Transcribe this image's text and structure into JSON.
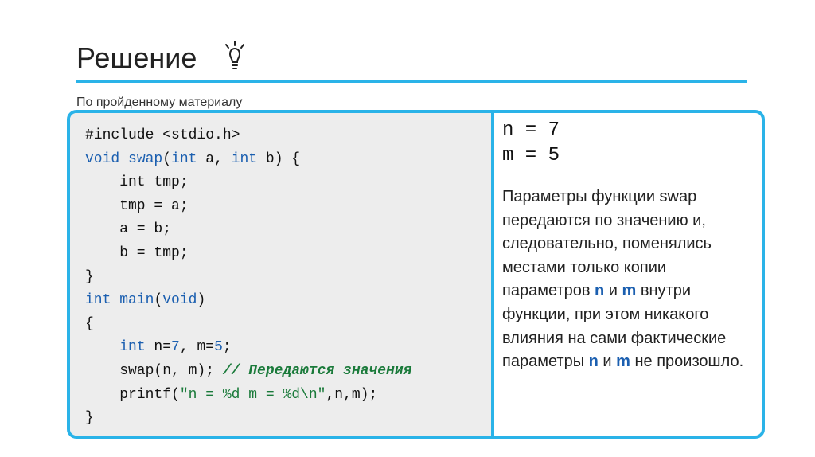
{
  "title": "Решение",
  "subtitle": "По пройденному материалу",
  "code": {
    "l1_a": "#include ",
    "l1_b": "<stdio.h>",
    "l2_a": "void",
    "l2_b": " ",
    "l2_c": "swap",
    "l2_d": "(",
    "l2_e": "int",
    "l2_f": " a, ",
    "l2_g": "int",
    "l2_h": " b) {",
    "l3": "    int tmp;",
    "l4": "    tmp = a;",
    "l5": "    a = b;",
    "l6": "    b = tmp;",
    "l7": "}",
    "l8_a": "int",
    "l8_b": " ",
    "l8_c": "main",
    "l8_d": "(",
    "l8_e": "void",
    "l8_f": ")",
    "l9": "{",
    "l10_a": "    ",
    "l10_b": "int",
    "l10_c": " n=",
    "l10_d": "7",
    "l10_e": ", m=",
    "l10_f": "5",
    "l10_g": ";",
    "l11_a": "    swap(n, m); ",
    "l11_b": "// Передаются значения",
    "l12_a": "    printf(",
    "l12_b": "\"n = %d m = %d\\n\"",
    "l12_c": ",n,m);",
    "l13": "}"
  },
  "output": {
    "line1": "n = 7",
    "line2": "m = 5"
  },
  "explanation": {
    "p1": "Параметры функции swap передаются по значению и, следовательно, поменялись местами только копии параметров ",
    "n1": "n",
    "p2": " и ",
    "m1": "m",
    "p3": " внутри функции, при этом никакого влияния на сами фактические параметры ",
    "n2": "n",
    "p4": " и ",
    "m2": "m",
    "p5": " не произошло."
  },
  "colors": {
    "accent": "#2ab3e8",
    "keyword": "#1b5fb0",
    "string_comment": "#1a7a3a",
    "code_bg": "#ededed"
  }
}
